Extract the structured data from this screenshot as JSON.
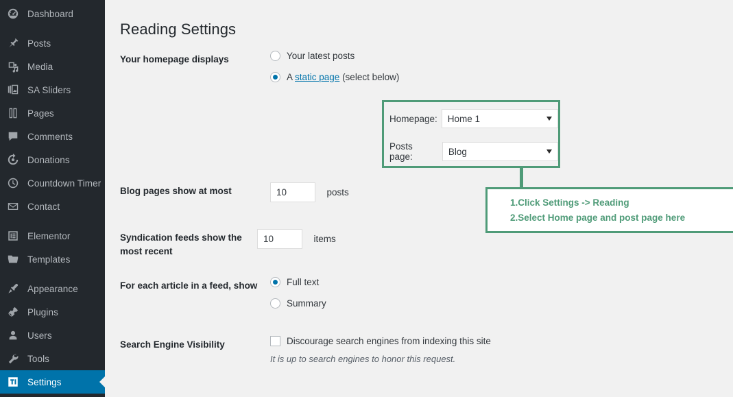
{
  "sidebar": {
    "items": [
      {
        "label": "Dashboard",
        "icon": "dashboard-icon",
        "active": false,
        "gap": false
      },
      {
        "label": "Posts",
        "icon": "pin-icon",
        "active": false,
        "gap": true
      },
      {
        "label": "Media",
        "icon": "media-icon",
        "active": false,
        "gap": false
      },
      {
        "label": "SA Sliders",
        "icon": "slides-icon",
        "active": false,
        "gap": false
      },
      {
        "label": "Pages",
        "icon": "pages-icon",
        "active": false,
        "gap": false
      },
      {
        "label": "Comments",
        "icon": "comment-icon",
        "active": false,
        "gap": false
      },
      {
        "label": "Donations",
        "icon": "donations-icon",
        "active": false,
        "gap": false
      },
      {
        "label": "Countdown Timer",
        "icon": "clock-icon",
        "active": false,
        "gap": false
      },
      {
        "label": "Contact",
        "icon": "email-icon",
        "active": false,
        "gap": false
      },
      {
        "label": "Elementor",
        "icon": "elementor-icon",
        "active": false,
        "gap": true
      },
      {
        "label": "Templates",
        "icon": "folder-icon",
        "active": false,
        "gap": false
      },
      {
        "label": "Appearance",
        "icon": "brush-icon",
        "active": false,
        "gap": true
      },
      {
        "label": "Plugins",
        "icon": "plugin-icon",
        "active": false,
        "gap": false
      },
      {
        "label": "Users",
        "icon": "user-icon",
        "active": false,
        "gap": false
      },
      {
        "label": "Tools",
        "icon": "wrench-icon",
        "active": false,
        "gap": false
      },
      {
        "label": "Settings",
        "icon": "settings-icon",
        "active": true,
        "gap": false
      }
    ]
  },
  "page": {
    "title": "Reading Settings"
  },
  "homepage_displays": {
    "label": "Your homepage displays",
    "option_latest": "Your latest posts",
    "option_static_prefix": "A ",
    "option_static_link": "static page",
    "option_static_suffix": " (select below)",
    "selected": "static"
  },
  "static_page_selects": {
    "homepage_label": "Homepage:",
    "homepage_value": "Home 1",
    "posts_label": "Posts page:",
    "posts_value": "Blog"
  },
  "blog_pages": {
    "label": "Blog pages show at most",
    "value": "10",
    "unit": "posts"
  },
  "syndication_feeds": {
    "label": "Syndication feeds show the most recent",
    "value": "10",
    "unit": "items"
  },
  "feed_article": {
    "label": "For each article in a feed, show",
    "option_full": "Full text",
    "option_summary": "Summary",
    "selected": "full"
  },
  "search_engine_visibility": {
    "label": "Search Engine Visibility",
    "checkbox_label": "Discourage search engines from indexing this site",
    "checked": false,
    "hint": "It is up to search engines to honor this request."
  },
  "annotation": {
    "line1": "1.Click Settings -> Reading",
    "line2": "2.Select Home page and post page here",
    "color": "#4f9b78"
  },
  "colors": {
    "sidebar_bg": "#23282d",
    "active_item": "#0073aa",
    "content_bg": "#f1f1f1",
    "accent_green": "#4f9b78",
    "link": "#0073aa"
  }
}
